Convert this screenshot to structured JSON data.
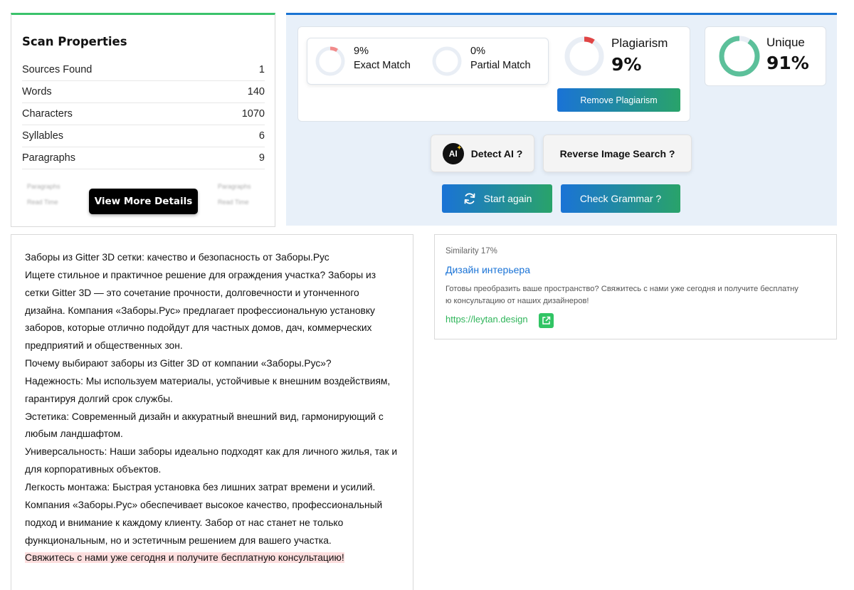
{
  "scan": {
    "title": "Scan Properties",
    "properties": [
      {
        "label": "Sources Found",
        "value": "1"
      },
      {
        "label": "Words",
        "value": "140"
      },
      {
        "label": "Characters",
        "value": "1070"
      },
      {
        "label": "Syllables",
        "value": "6"
      },
      {
        "label": "Paragraphs",
        "value": "9"
      }
    ],
    "blurred": [
      "Paragraphs",
      "Read Time",
      "Paragraphs",
      "Read Time"
    ],
    "view_more_label": "View More Details"
  },
  "results": {
    "exact": {
      "percent": "9%",
      "label": "Exact Match",
      "fraction": 0.09
    },
    "partial": {
      "percent": "0%",
      "label": "Partial Match",
      "fraction": 0.0
    },
    "plagiarism": {
      "label": "Plagiarism",
      "value": "9%",
      "fraction": 0.09
    },
    "unique": {
      "label": "Unique",
      "value": "91%",
      "fraction": 0.91
    },
    "remove_label": "Remove Plagiarism",
    "detect_ai_label": "Detect AI ?",
    "ai_icon_text": "AI",
    "reverse_label": "Reverse Image Search ?",
    "start_label": "Start again",
    "grammar_label": "Check Grammar ?"
  },
  "text": {
    "lines": [
      "Заборы из Gitter 3D сетки: качество и безопасность от Заборы.Рус",
      "Ищете стильное и практичное решение для ограждения участка? Заборы из",
      "сетки Gitter 3D — это сочетание прочности, долговечности и утонченного",
      "дизайна. Компания «Заборы.Рус» предлагает профессиональную установку",
      "заборов, которые отлично подойдут для частных домов, дач, коммерческих",
      "предприятий и общественных зон.",
      "Почему выбирают заборы из Gitter 3D от компании «Заборы.Рус»?",
      "Надежность: Мы используем материалы, устойчивые к внешним воздействиям,",
      "гарантируя долгий срок службы.",
      "Эстетика: Современный дизайн и аккуратный внешний вид, гармонирующий с",
      "любым ландшафтом.",
      "Универсальность: Наши заборы идеально подходят как для личного жилья, так и",
      "для корпоративных объектов.",
      "Легкость монтажа: Быстрая установка без лишних затрат времени и усилий.",
      "Компания «Заборы.Рус» обеспечивает высокое качество, профессиональный",
      "подход и внимание к каждому клиенту. Забор от нас станет не только",
      "функциональным, но и эстетичным решением для вашего участка."
    ],
    "highlighted": "Свяжитесь с нами уже сегодня и получите бесплатную консультацию!"
  },
  "source": {
    "similarity": "Similarity 17%",
    "title": "Дизайн интерьера",
    "description_line1": "Готовы преобразить ваше пространство? Свяжитесь с нами уже сегодня и получите бесплатну",
    "description_line2": "ю консультацию от наших дизайнеров!",
    "url": "https://leytan.design"
  },
  "colors": {
    "green_accent": "#3ac36b",
    "blue_accent": "#1a74d3",
    "plagiarism_red": "#e04545",
    "exact_pink": "#f28b8b",
    "unique_teal": "#5cc09a",
    "ring_track": "#e9eef5",
    "highlight_bg": "#fddede"
  }
}
